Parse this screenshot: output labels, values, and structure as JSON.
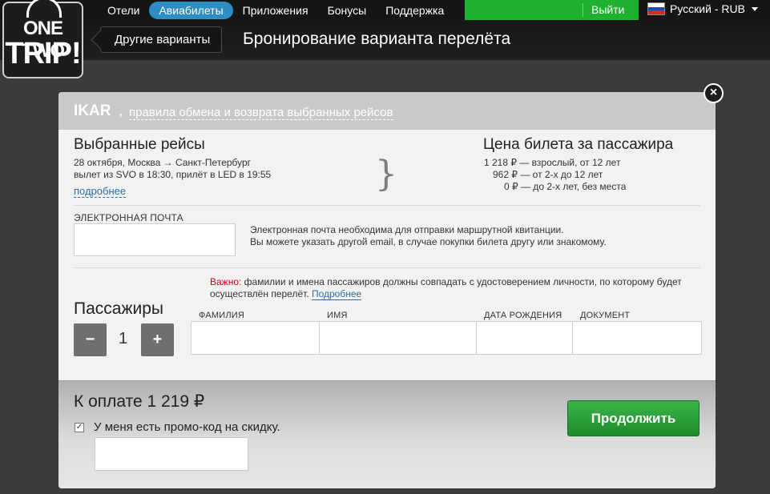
{
  "topnav": {
    "items": [
      {
        "label": "Отели",
        "active": false
      },
      {
        "label": "Авиабилеты",
        "active": true
      },
      {
        "label": "Приложения",
        "active": false
      },
      {
        "label": "Бонусы",
        "active": false
      },
      {
        "label": "Поддержка",
        "active": false
      }
    ],
    "login_label": "Выйти",
    "language_label": "Русский - RUB"
  },
  "logo": {
    "line1": "ONE TWO",
    "line2": "TRIP!"
  },
  "header": {
    "back_label": "Другие варианты",
    "title": "Бронирование варианта перелёта"
  },
  "modal": {
    "carrier": "IKAR",
    "comma": ",",
    "rules_link": "правила обмена и возврата выбранных рейсов",
    "close_glyph": "×",
    "flights": {
      "title": "Выбранные рейсы",
      "route": "28 октября, Москва → Санкт-Петербург",
      "times": "вылет из SVO в 18:30, прилёт в LED в 19:55",
      "more_link": "подробнее",
      "brace": "}"
    },
    "price": {
      "title": "Цена билета за пассажира",
      "rows": [
        "1 218 ₽ — взрослый, от 12 лет",
        "962 ₽ — от 2-х до 12 лет",
        "0 ₽ — до 2-х лет, без места"
      ]
    },
    "email": {
      "label": "ЭЛЕКТРОННАЯ ПОЧТА",
      "value": "",
      "note_line1": "Электронная почта необходима для отправки маршрутной квитанции.",
      "note_line2": "Вы можете указать другой email, в случае покупки билета другу или знакомому."
    },
    "passengers": {
      "title": "Пассажиры",
      "count": "1",
      "minus": "−",
      "plus": "+",
      "important_label": "Важно:",
      "important_text": " фамилии и имена пассажиров должны совпадать с удостоверением личности, по которому будет осуществлён перелёт.",
      "more_link": "Подробнее",
      "columns": [
        "ФАМИЛИЯ",
        "ИМЯ",
        "ДАТА РОЖДЕНИЯ",
        "ДОКУМЕНТ"
      ]
    },
    "footer": {
      "total": "К оплате 1 219 ₽",
      "promo_checked": true,
      "promo_check_glyph": "✓",
      "promo_label": "У меня есть промо-код на скидку.",
      "promo_value": "",
      "continue_label": "Продолжить"
    }
  },
  "colors": {
    "accent_blue": "#2d8ec4",
    "login_green": "#1fb02d",
    "continue_green": "#2aa13a",
    "important_red": "#d0021b"
  }
}
